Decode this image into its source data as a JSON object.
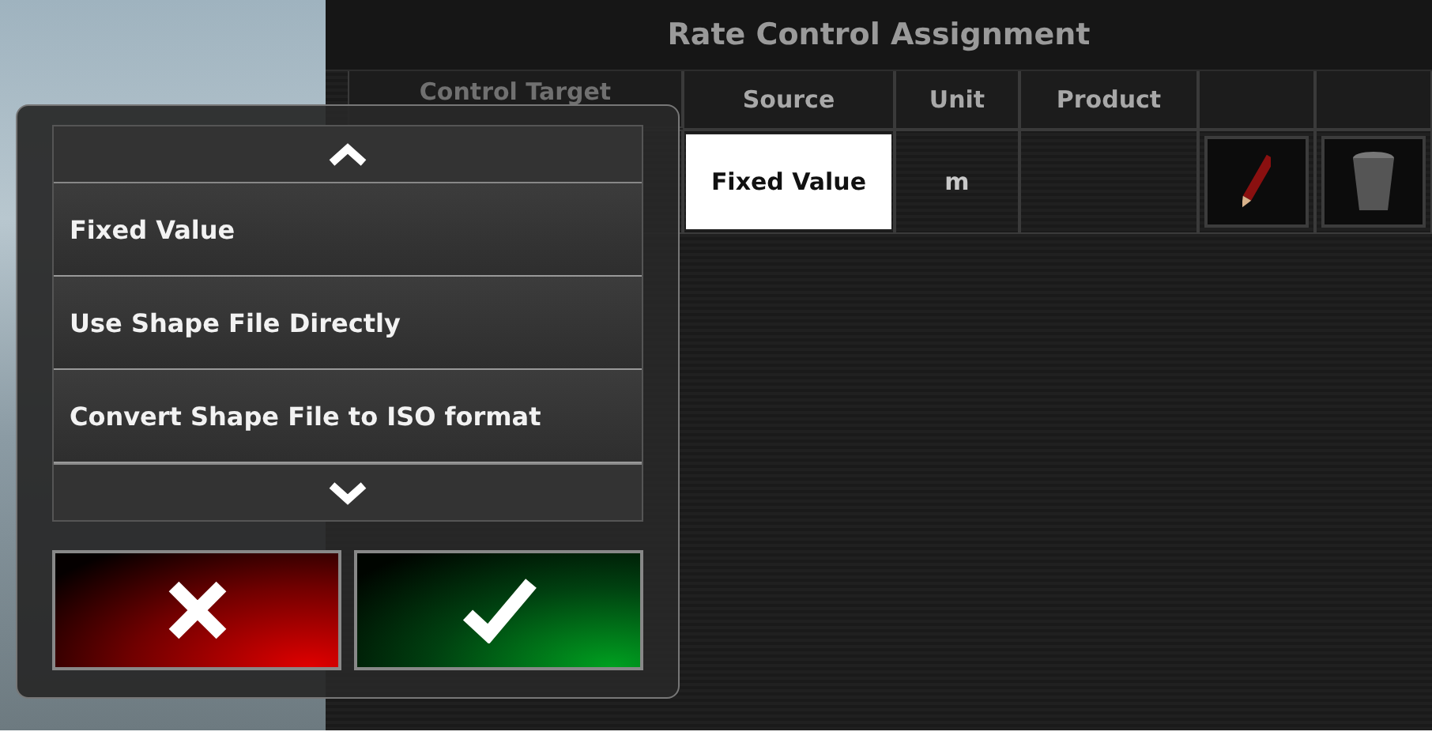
{
  "screen": {
    "title": "Rate Control Assignment"
  },
  "table": {
    "columns": [
      "Control Target",
      "Source",
      "Unit",
      "Product"
    ],
    "rows": [
      {
        "source": "Fixed Value",
        "unit": "m"
      }
    ]
  },
  "picker": {
    "options": [
      "Fixed Value",
      "Use Shape File Directly",
      "Convert Shape File to ISO format"
    ]
  }
}
